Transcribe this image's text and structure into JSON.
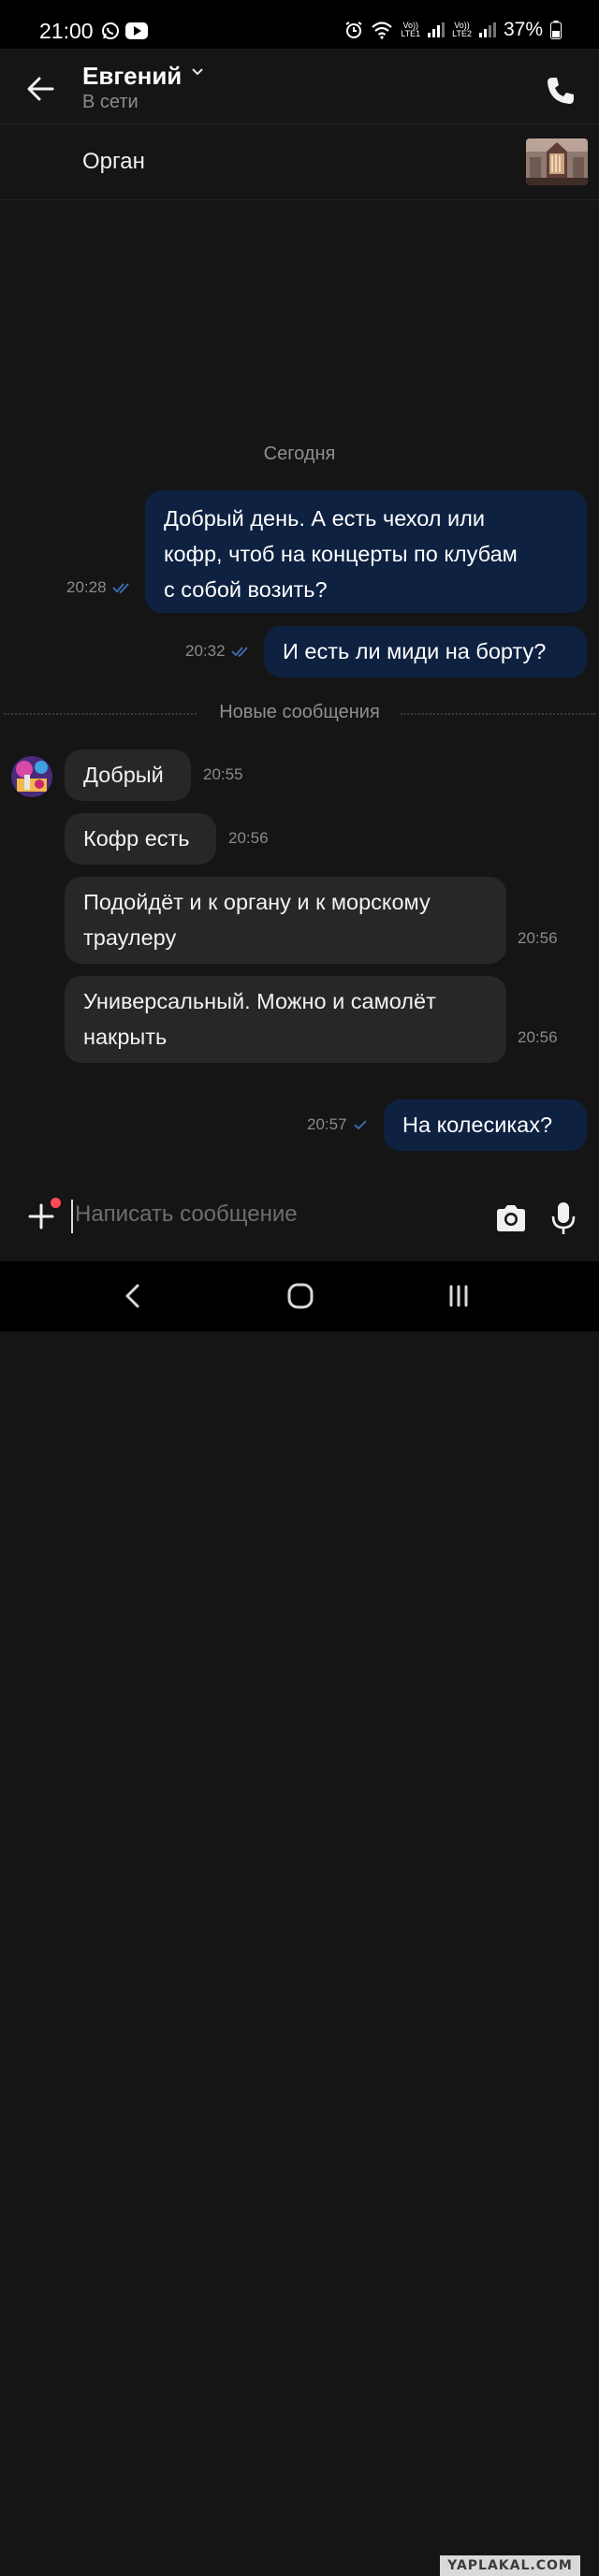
{
  "status_bar": {
    "time": "21:00",
    "sim1_label": "LTE1",
    "sim2_label": "LTE2",
    "volte": "Vo))",
    "battery": "37%"
  },
  "header": {
    "contact_name": "Евгений",
    "contact_status": "В сети"
  },
  "topic": {
    "label": "Орган"
  },
  "date_separator": "Сегодня",
  "new_messages_separator": "Новые сообщения",
  "messages": [
    {
      "direction": "out",
      "lines": [
        "Добрый день. А есть чехол или",
        "кофр, чтоб на концерты по клубам",
        "с собой возить?"
      ],
      "time": "20:28",
      "read": true
    },
    {
      "direction": "out",
      "lines": [
        "И есть ли миди на борту?"
      ],
      "time": "20:32",
      "read": true
    },
    {
      "direction": "in",
      "lines": [
        "Добрый"
      ],
      "time": "20:55"
    },
    {
      "direction": "in",
      "lines": [
        "Кофр есть"
      ],
      "time": "20:56"
    },
    {
      "direction": "in",
      "lines": [
        "Подойдёт и к органу и к морскому",
        "траулеру"
      ],
      "time": "20:56"
    },
    {
      "direction": "in",
      "lines": [
        "Универсальный. Можно и самолёт",
        "накрыть"
      ],
      "time": "20:56"
    },
    {
      "direction": "out",
      "lines": [
        "На колесиках?"
      ],
      "time": "20:57",
      "read": false
    }
  ],
  "composer": {
    "placeholder": "Написать сообщение"
  },
  "watermark": "YAPLAKAL.COM",
  "colors": {
    "outgoing_bubble": "#0e2141",
    "incoming_bubble": "#272727",
    "background": "#151515",
    "read_check": "#3e6fb8"
  }
}
